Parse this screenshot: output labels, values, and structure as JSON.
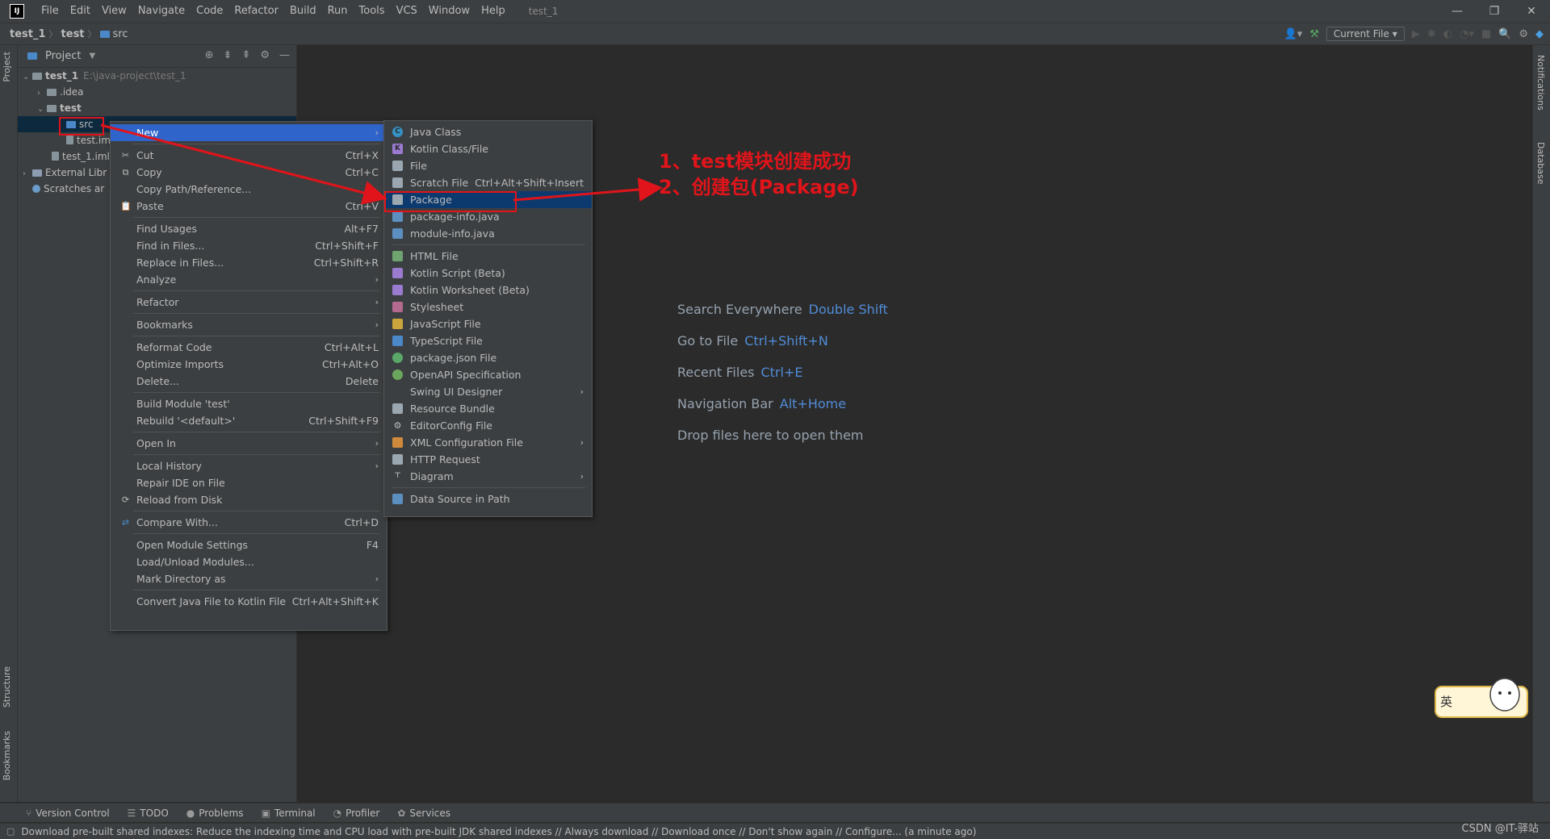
{
  "app": {
    "window_title": "test_1",
    "menu": [
      "File",
      "Edit",
      "View",
      "Navigate",
      "Code",
      "Refactor",
      "Build",
      "Run",
      "Tools",
      "VCS",
      "Window",
      "Help"
    ]
  },
  "breadcrumb": [
    "test_1",
    "test",
    "src"
  ],
  "toolbar": {
    "run_config": "Current File"
  },
  "left_strip": {
    "project": "Project",
    "structure": "Structure",
    "bookmarks": "Bookmarks"
  },
  "right_strip": {
    "notifications": "Notifications",
    "database": "Database"
  },
  "project_panel": {
    "title": "Project",
    "tree": [
      {
        "label": "test_1",
        "path": "E:\\java-project\\test_1"
      },
      {
        "label": ".idea"
      },
      {
        "label": "test"
      },
      {
        "label": "src"
      },
      {
        "label": "test.im"
      },
      {
        "label": "test_1.iml"
      },
      {
        "label": "External Libr"
      },
      {
        "label": "Scratches ar"
      }
    ]
  },
  "editor_hints": [
    {
      "label": "Search Everywhere",
      "key": "Double Shift"
    },
    {
      "label": "Go to File",
      "key": "Ctrl+Shift+N"
    },
    {
      "label": "Recent Files",
      "key": "Ctrl+E"
    },
    {
      "label": "Navigation Bar",
      "key": "Alt+Home"
    },
    {
      "label": "Drop files here to open them",
      "key": ""
    }
  ],
  "context_menu": [
    {
      "label": "New",
      "shortcut": "",
      "submenu": true
    },
    {
      "label": "Cut",
      "shortcut": "Ctrl+X"
    },
    {
      "label": "Copy",
      "shortcut": "Ctrl+C"
    },
    {
      "label": "Copy Path/Reference...",
      "shortcut": ""
    },
    {
      "label": "Paste",
      "shortcut": "Ctrl+V"
    },
    {
      "label": "Find Usages",
      "shortcut": "Alt+F7"
    },
    {
      "label": "Find in Files...",
      "shortcut": "Ctrl+Shift+F"
    },
    {
      "label": "Replace in Files...",
      "shortcut": "Ctrl+Shift+R"
    },
    {
      "label": "Analyze",
      "shortcut": "",
      "submenu": true
    },
    {
      "label": "Refactor",
      "shortcut": "",
      "submenu": true
    },
    {
      "label": "Bookmarks",
      "shortcut": "",
      "submenu": true
    },
    {
      "label": "Reformat Code",
      "shortcut": "Ctrl+Alt+L"
    },
    {
      "label": "Optimize Imports",
      "shortcut": "Ctrl+Alt+O"
    },
    {
      "label": "Delete...",
      "shortcut": "Delete"
    },
    {
      "label": "Build Module 'test'",
      "shortcut": ""
    },
    {
      "label": "Rebuild '<default>'",
      "shortcut": "Ctrl+Shift+F9"
    },
    {
      "label": "Open In",
      "shortcut": "",
      "submenu": true
    },
    {
      "label": "Local History",
      "shortcut": "",
      "submenu": true
    },
    {
      "label": "Repair IDE on File",
      "shortcut": ""
    },
    {
      "label": "Reload from Disk",
      "shortcut": ""
    },
    {
      "label": "Compare With...",
      "shortcut": "Ctrl+D"
    },
    {
      "label": "Open Module Settings",
      "shortcut": "F4"
    },
    {
      "label": "Load/Unload Modules...",
      "shortcut": ""
    },
    {
      "label": "Mark Directory as",
      "shortcut": "",
      "submenu": true
    },
    {
      "label": "Convert Java File to Kotlin File",
      "shortcut": "Ctrl+Alt+Shift+K"
    }
  ],
  "new_submenu": [
    {
      "label": "Java Class",
      "shortcut": ""
    },
    {
      "label": "Kotlin Class/File",
      "shortcut": ""
    },
    {
      "label": "File",
      "shortcut": ""
    },
    {
      "label": "Scratch File",
      "shortcut": "Ctrl+Alt+Shift+Insert"
    },
    {
      "label": "Package",
      "shortcut": ""
    },
    {
      "label": "package-info.java",
      "shortcut": ""
    },
    {
      "label": "module-info.java",
      "shortcut": ""
    },
    {
      "label": "HTML File",
      "shortcut": ""
    },
    {
      "label": "Kotlin Script (Beta)",
      "shortcut": ""
    },
    {
      "label": "Kotlin Worksheet (Beta)",
      "shortcut": ""
    },
    {
      "label": "Stylesheet",
      "shortcut": ""
    },
    {
      "label": "JavaScript File",
      "shortcut": ""
    },
    {
      "label": "TypeScript File",
      "shortcut": ""
    },
    {
      "label": "package.json File",
      "shortcut": ""
    },
    {
      "label": "OpenAPI Specification",
      "shortcut": ""
    },
    {
      "label": "Swing UI Designer",
      "shortcut": "",
      "submenu": true
    },
    {
      "label": "Resource Bundle",
      "shortcut": ""
    },
    {
      "label": "EditorConfig File",
      "shortcut": ""
    },
    {
      "label": "XML Configuration File",
      "shortcut": "",
      "submenu": true
    },
    {
      "label": "HTTP Request",
      "shortcut": ""
    },
    {
      "label": "Diagram",
      "shortcut": "",
      "submenu": true
    },
    {
      "label": "Data Source in Path",
      "shortcut": ""
    }
  ],
  "annotations": {
    "line1": "1、test模块创建成功",
    "line2": "2、创建包(Package)"
  },
  "tool_windows": [
    "Version Control",
    "TODO",
    "Problems",
    "Terminal",
    "Profiler",
    "Services"
  ],
  "status": {
    "message": "Download pre-built shared indexes: Reduce the indexing time and CPU load with pre-built JDK shared indexes // Always download // Download once // Don't show again // Configure... (a minute ago)",
    "watermark": "CSDN @IT-驿站"
  },
  "sticker": {
    "text": "英"
  },
  "colors": {
    "accent": "#2f65ca",
    "annotation": "#e0141a",
    "link": "#589df6"
  }
}
